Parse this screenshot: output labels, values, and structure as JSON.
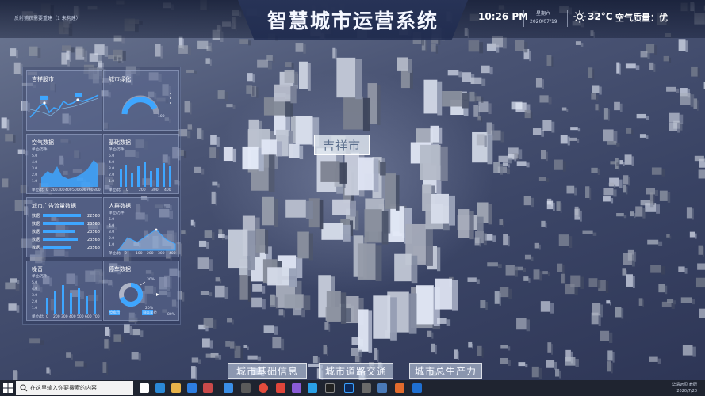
{
  "header": {
    "title": "智慧城市运营系统",
    "hint": "反射捕获需要重建（1 未构建）",
    "time": "10:26 PM",
    "weekday": "星期六",
    "date": "2020/07/19",
    "temperature": "32°C",
    "air_quality": "空气质量：优"
  },
  "map": {
    "city_label": "吉祥市"
  },
  "panels": {
    "stock": {
      "title": "吉祥股市"
    },
    "greening": {
      "title": "城市绿化",
      "tick_max": "100"
    },
    "air": {
      "title": "空气数据",
      "unit": "单位/万件",
      "y_ticks": [
        "5.0",
        "4.0",
        "3.0",
        "2.0",
        "1.0"
      ],
      "x_ticks": [
        "0",
        "200",
        "300",
        "400",
        "500",
        "600",
        "700",
        "800"
      ],
      "axis_origin": "单位/比"
    },
    "basic": {
      "title": "基础数据",
      "unit": "单位/万件",
      "y_ticks": [
        "5.0",
        "4.0",
        "3.0",
        "2.0",
        "1.0"
      ],
      "x_ticks": [
        "0",
        "200",
        "300",
        "400"
      ],
      "axis_origin": "单位/比"
    },
    "traffic": {
      "title": "城市广告流量数据",
      "rows": [
        {
          "label": "数据",
          "value": "22568"
        },
        {
          "label": "数据",
          "value": "23568"
        },
        {
          "label": "数据",
          "value": "23568"
        },
        {
          "label": "数据",
          "value": "23568"
        },
        {
          "label": "数据",
          "value": "23568"
        }
      ]
    },
    "crowd": {
      "title": "人群数据",
      "unit": "单位/万件",
      "y_ticks": [
        "5.0",
        "4.0",
        "3.0",
        "2.0",
        "1.0"
      ],
      "x_ticks": [
        "0",
        "100",
        "200",
        "300",
        "400"
      ],
      "axis_origin": "单位/比"
    },
    "noise": {
      "title": "噪音",
      "unit": "单位/万件",
      "y_ticks": [
        "5.0",
        "4.0",
        "3.0",
        "2.0",
        "1.0"
      ],
      "x_ticks": [
        "0",
        "200",
        "300",
        "400",
        "500",
        "600",
        "700"
      ],
      "axis_origin": "单位/比"
    },
    "parking": {
      "title": "停车数据",
      "percent_a": "30%",
      "percent_b": "20%",
      "percent_c": "80%",
      "legend_a": "空车位",
      "legend_b": "剩余车位"
    }
  },
  "nav": {
    "items": [
      "城市基础信息",
      "城市道路交通",
      "城市总生产力"
    ]
  },
  "taskbar": {
    "search_placeholder": "在这里输入你要搜索的内容",
    "tray_line1": "华清远见 教研",
    "tray_line2": "2020/7/20"
  },
  "colors": {
    "accent": "#3ea6ff",
    "panel_bg": "#6e7da5",
    "taskbar": "#1f2430"
  }
}
